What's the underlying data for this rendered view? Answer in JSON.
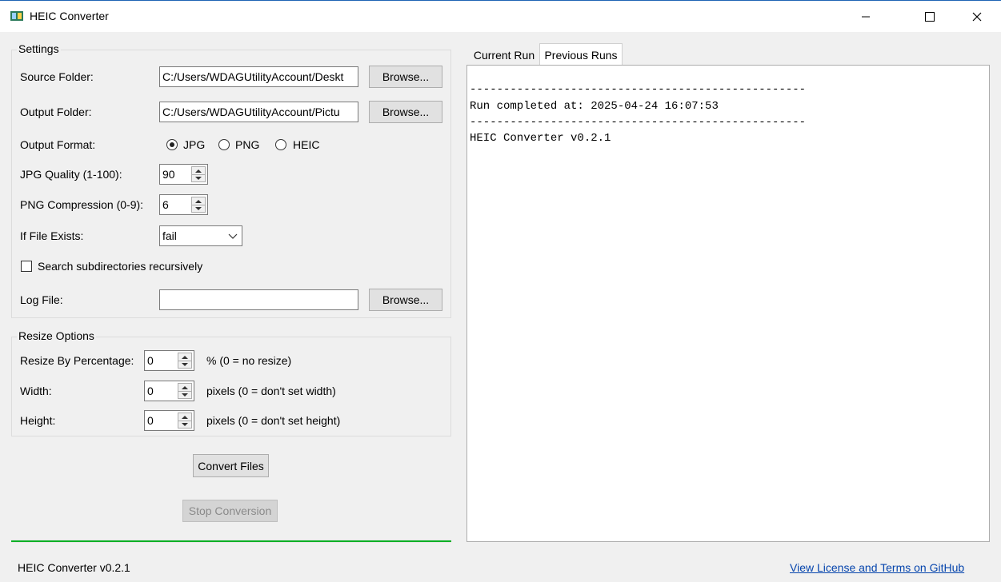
{
  "window": {
    "title": "HEIC Converter"
  },
  "settings": {
    "title": "Settings",
    "source_folder": {
      "label": "Source Folder:",
      "value": "C:/Users/WDAGUtilityAccount/Deskt",
      "browse": "Browse..."
    },
    "output_folder": {
      "label": "Output Folder:",
      "value": "C:/Users/WDAGUtilityAccount/Pictu",
      "browse": "Browse..."
    },
    "output_format": {
      "label": "Output Format:",
      "options": [
        "JPG",
        "PNG",
        "HEIC"
      ],
      "selected": "JPG"
    },
    "jpg_quality": {
      "label": "JPG Quality (1-100):",
      "value": "90"
    },
    "png_compression": {
      "label": "PNG Compression (0-9):",
      "value": "6"
    },
    "if_file_exists": {
      "label": "If File Exists:",
      "value": "fail"
    },
    "recursive": {
      "label": "Search subdirectories recursively",
      "checked": false
    },
    "log_file": {
      "label": "Log File:",
      "value": "",
      "browse": "Browse..."
    }
  },
  "resize": {
    "title": "Resize Options",
    "percentage": {
      "label": "Resize By Percentage:",
      "value": "0",
      "hint": "% (0 = no resize)"
    },
    "width": {
      "label": "Width:",
      "value": "0",
      "hint": "pixels (0 = don't set width)"
    },
    "height": {
      "label": "Height:",
      "value": "0",
      "hint": "pixels (0 = don't set height)"
    }
  },
  "actions": {
    "convert": "Convert Files",
    "stop": "Stop Conversion"
  },
  "progress": {
    "fraction": 1.0,
    "color": "#06b025"
  },
  "tabs": {
    "items": [
      "Current Run",
      "Previous Runs"
    ],
    "active": "Previous Runs"
  },
  "log": {
    "lines": [
      "--------------------------------------------------",
      "Run completed at: 2025-04-24 16:07:53",
      "--------------------------------------------------",
      "HEIC Converter v0.2.1"
    ]
  },
  "footer": {
    "version": "HEIC Converter v0.2.1",
    "link": "View License and Terms on GitHub"
  }
}
